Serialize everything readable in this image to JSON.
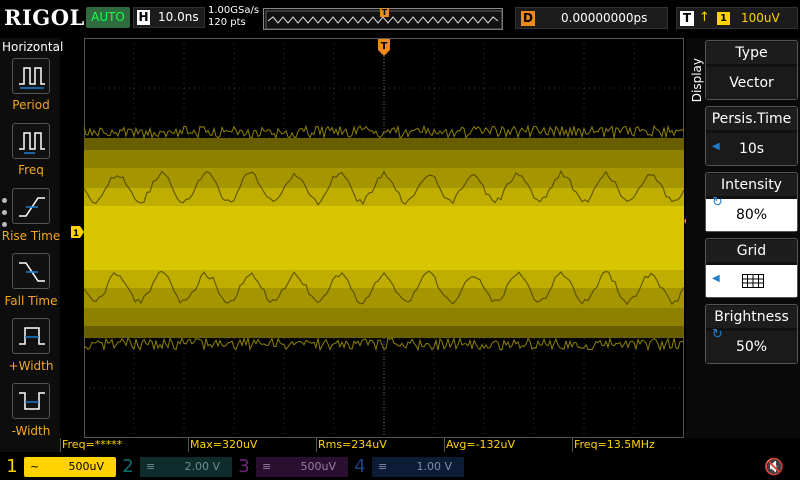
{
  "top_bar": {
    "logo": "RIGOL",
    "run_mode": "AUTO",
    "horizontal": {
      "label": "H",
      "value": "10.0ns"
    },
    "sample_rate": "1.00GSa/s",
    "points": "120 pts",
    "trigger_position_marker": "T",
    "delay": {
      "label": "D",
      "value": "0.00000000ps"
    },
    "trigger": {
      "label": "T",
      "edge_icon": "rising-edge-icon",
      "channel": "1",
      "level": "100uV"
    }
  },
  "left_panel": {
    "title": "Horizontal",
    "items": [
      {
        "label": "Period",
        "icon": "period-icon"
      },
      {
        "label": "Freq",
        "icon": "freq-icon"
      },
      {
        "label": "Rise Time",
        "icon": "rise-time-icon"
      },
      {
        "label": "Fall Time",
        "icon": "fall-time-icon"
      },
      {
        "label": "+Width",
        "icon": "positive-width-icon"
      },
      {
        "label": "-Width",
        "icon": "negative-width-icon"
      }
    ]
  },
  "right_panel": {
    "vertical_label": "Display",
    "items": [
      {
        "title": "Type",
        "value": "Vector",
        "indicator": ""
      },
      {
        "title": "Persis.Time",
        "value": "10s",
        "indicator": "left-arrow"
      },
      {
        "title": "Intensity",
        "value": "80%",
        "indicator": "rotate-knob"
      },
      {
        "title": "Grid",
        "value": "",
        "indicator": "left-arrow",
        "value_icon": "grid-icon"
      },
      {
        "title": "Brightness",
        "value": "50%",
        "indicator": "rotate-knob"
      }
    ]
  },
  "markers": {
    "trigger_top": "T",
    "channel1_ground": "1"
  },
  "measurements": [
    "Freq=*****",
    "Max=320uV",
    "Rms=234uV",
    "Avg=-132uV",
    "Freq=13.5MHz"
  ],
  "channels": [
    {
      "num": "1",
      "coupling_icon": "ac-coupling-icon",
      "scale": "500uV",
      "active": true
    },
    {
      "num": "2",
      "coupling_icon": "dc-coupling-icon",
      "scale": "2.00 V",
      "active": false
    },
    {
      "num": "3",
      "coupling_icon": "dc-coupling-icon",
      "scale": "500uV",
      "active": false
    },
    {
      "num": "4",
      "coupling_icon": "dc-coupling-icon",
      "scale": "1.00 V",
      "active": false
    }
  ],
  "colors": {
    "ch1": "#ffd200",
    "ch2": "#19b8b8",
    "ch3": "#c23ad6",
    "ch4": "#2f6fe0",
    "trace": "#bfae00",
    "accent_orange": "#f18a1c"
  }
}
